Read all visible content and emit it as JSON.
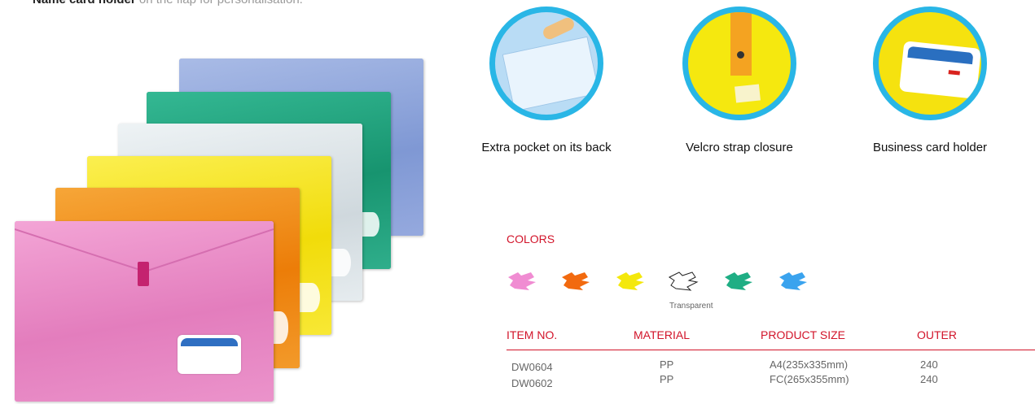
{
  "intro": {
    "bold": "Name card holder",
    "rest": " on the flap for personalisation."
  },
  "features": [
    {
      "label": "Extra pocket on its back"
    },
    {
      "label": "Velcro strap closure"
    },
    {
      "label": "Business card holder"
    }
  ],
  "colors": {
    "title": "COLORS",
    "swatches": [
      {
        "name": "pink",
        "hex": "#f08cd2"
      },
      {
        "name": "orange",
        "hex": "#f26a0f"
      },
      {
        "name": "yellow",
        "hex": "#f4e80c"
      },
      {
        "name": "transparent",
        "hex": "#ffffff"
      },
      {
        "name": "green",
        "hex": "#1fae84"
      },
      {
        "name": "blue",
        "hex": "#3aa3ee"
      }
    ],
    "transparent_label": "Transparent"
  },
  "table": {
    "headers": [
      "ITEM NO.",
      "MATERIAL",
      "PRODUCT SIZE",
      "OUTER"
    ],
    "rows": [
      [
        "DW0604",
        "PP",
        "A4(235x335mm)",
        "240"
      ],
      [
        "DW0602",
        "PP",
        "FC(265x355mm)",
        "240"
      ]
    ]
  }
}
